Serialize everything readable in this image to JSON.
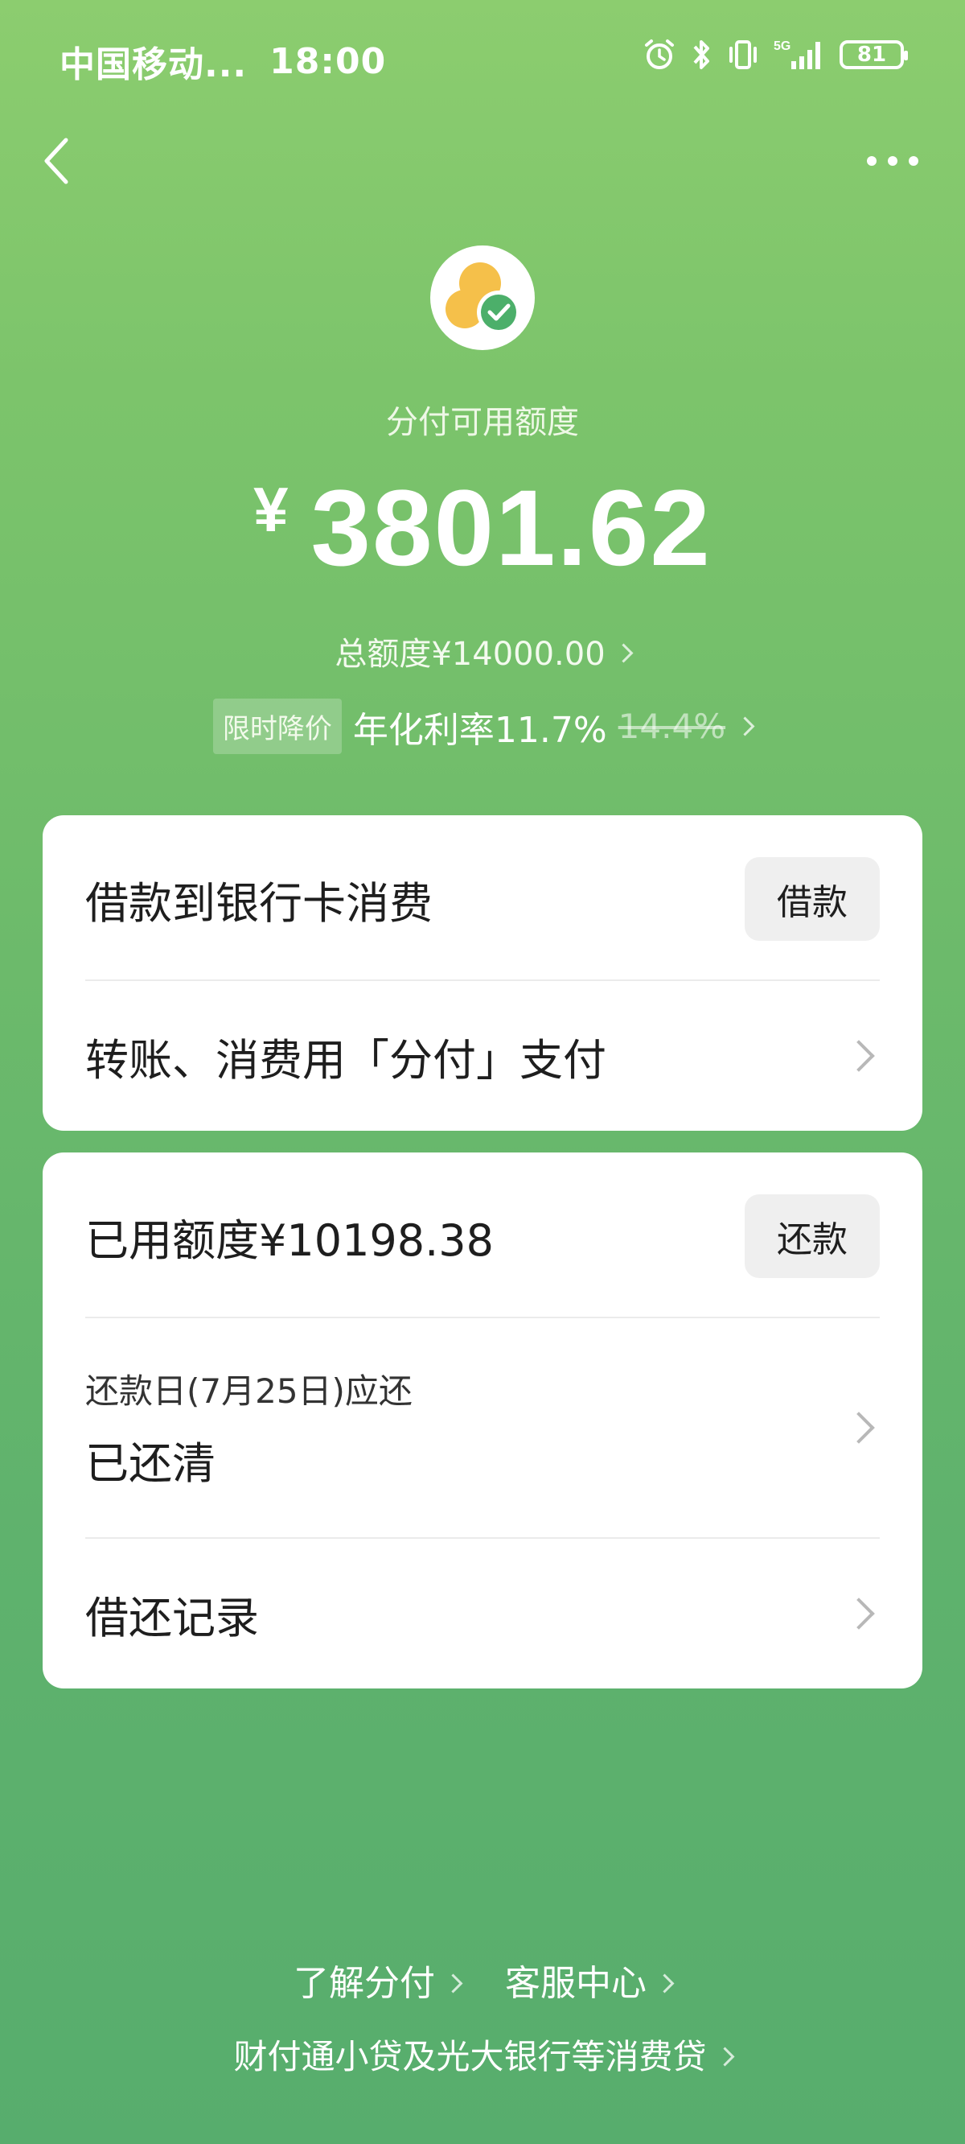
{
  "status_bar": {
    "carrier": "中国移动...",
    "time": "18:00",
    "network": "5G",
    "battery": "81"
  },
  "header": {
    "available_label": "分付可用额度",
    "currency": "¥",
    "available_amount": "3801.62",
    "total_limit": "总额度¥14000.00",
    "promo_tag": "限时降价",
    "rate": "年化利率11.7%",
    "old_rate": "14.4%"
  },
  "card1": {
    "borrow_text": "借款到银行卡消费",
    "borrow_button": "借款",
    "pay_text": "转账、消费用「分付」支付"
  },
  "card2": {
    "used_text": "已用额度¥10198.38",
    "repay_button": "还款",
    "due_label": "还款日(7月25日)应还",
    "due_status": "已还清",
    "records_text": "借还记录"
  },
  "footer": {
    "learn_link": "了解分付",
    "service_link": "客服中心",
    "lender_note": "财付通小贷及光大银行等消费贷"
  },
  "colors": {
    "bg_top": "#8ccd6f",
    "bg_bottom": "#57ad6d",
    "card_bg": "#ffffff",
    "button_bg": "#efefef",
    "logo_yellow": "#f5c04a",
    "logo_green": "#4caf6a"
  }
}
